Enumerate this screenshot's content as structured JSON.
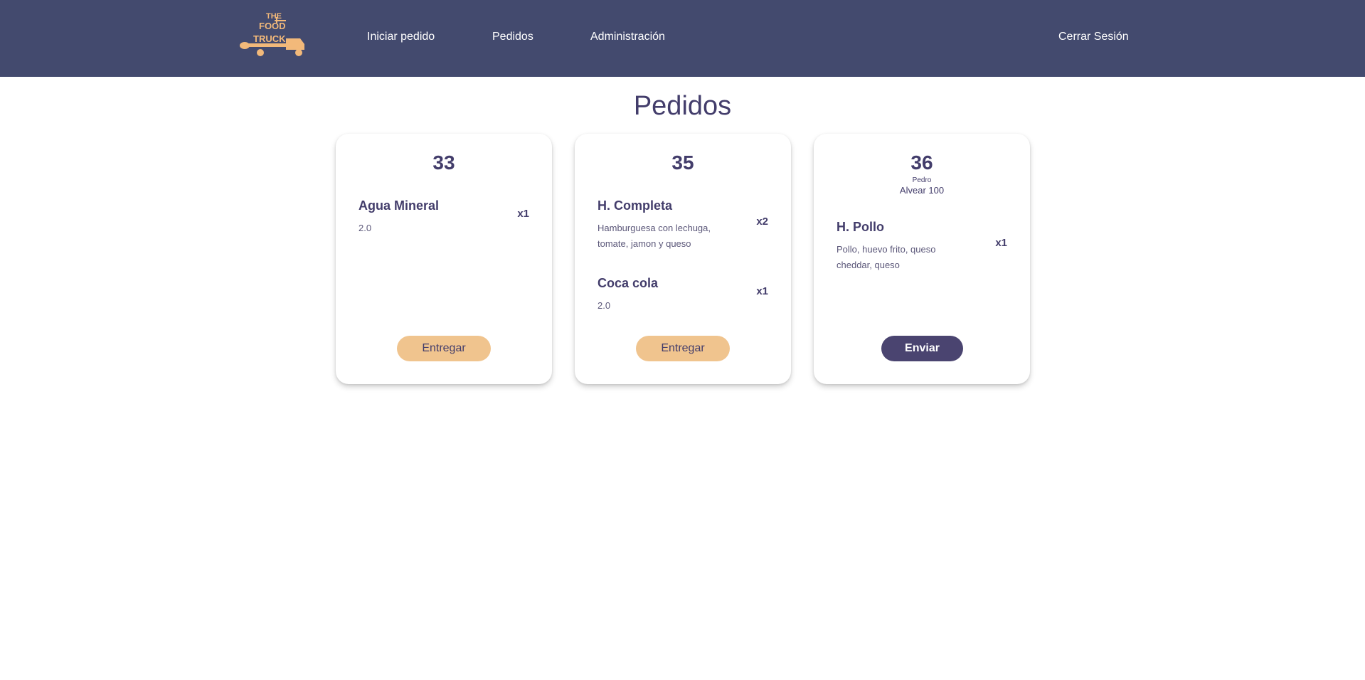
{
  "colors": {
    "navbar": "#434a6e",
    "accent_text": "#433d6b",
    "deliver_button": "#f0c48e",
    "send_button": "#4a4470",
    "logo": "#f2b97a"
  },
  "logo": {
    "text_lines": [
      "THE",
      "FOOD",
      "TRUCK"
    ]
  },
  "nav": {
    "new_order": "Iniciar pedido",
    "orders": "Pedidos",
    "admin": "Administración",
    "logout": "Cerrar Sesión"
  },
  "page": {
    "title": "Pedidos"
  },
  "orders": [
    {
      "number": "33",
      "items": [
        {
          "name": "Agua Mineral",
          "desc": "2.0",
          "qty": "x1"
        }
      ],
      "action": "Entregar"
    },
    {
      "number": "35",
      "items": [
        {
          "name": "H. Completa",
          "desc": "Hamburguesa con lechuga, tomate, jamon y queso",
          "qty": "x2"
        },
        {
          "name": "Coca cola",
          "desc": "2.0",
          "qty": "x1"
        }
      ],
      "action": "Entregar"
    },
    {
      "number": "36",
      "customer": "Pedro",
      "address": "Alvear 100",
      "items": [
        {
          "name": "H. Pollo",
          "desc": "Pollo, huevo frito, queso cheddar, queso",
          "qty": "x1"
        }
      ],
      "action": "Enviar"
    }
  ]
}
